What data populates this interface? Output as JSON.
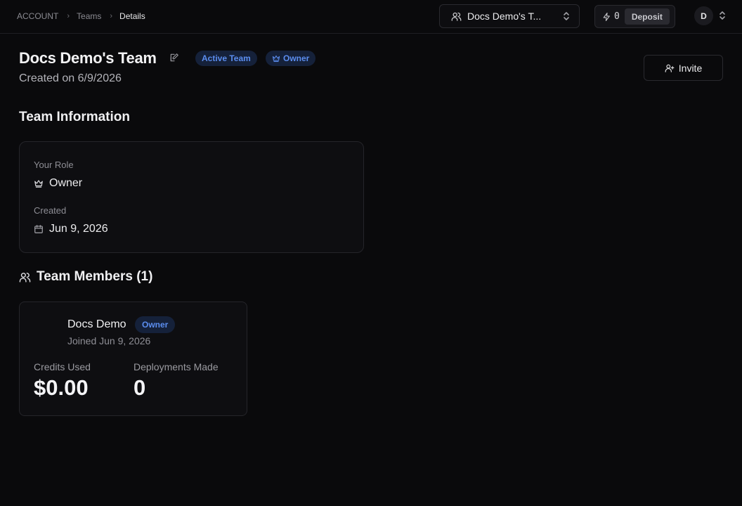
{
  "breadcrumb": {
    "root": "ACCOUNT",
    "teams": "Teams",
    "current": "Details"
  },
  "team_switcher": {
    "label": "Docs Demo's T...",
    "icon": "users-icon"
  },
  "credits": {
    "count": "0",
    "deposit_label": "Deposit",
    "icon": "lightning-icon"
  },
  "user": {
    "initial": "D"
  },
  "header": {
    "title": "Docs Demo's Team",
    "badge_active": "Active Team",
    "badge_owner": "Owner",
    "created": "Created on 6/9/2026",
    "invite_label": "Invite"
  },
  "team_info": {
    "section_title": "Team Information",
    "role_label": "Your Role",
    "role_value": "Owner",
    "created_label": "Created",
    "created_value": "Jun 9, 2026"
  },
  "members": {
    "section_title": "Team Members (1)",
    "list": [
      {
        "name": "Docs Demo",
        "role": "Owner",
        "joined": "Joined Jun 9, 2026",
        "credits_label": "Credits Used",
        "credits_value": "$0.00",
        "deployments_label": "Deployments Made",
        "deployments_value": "0"
      }
    ]
  },
  "colors": {
    "background": "#0a0a0c",
    "accent": "#5b8def",
    "badge_bg": "#15213a"
  }
}
